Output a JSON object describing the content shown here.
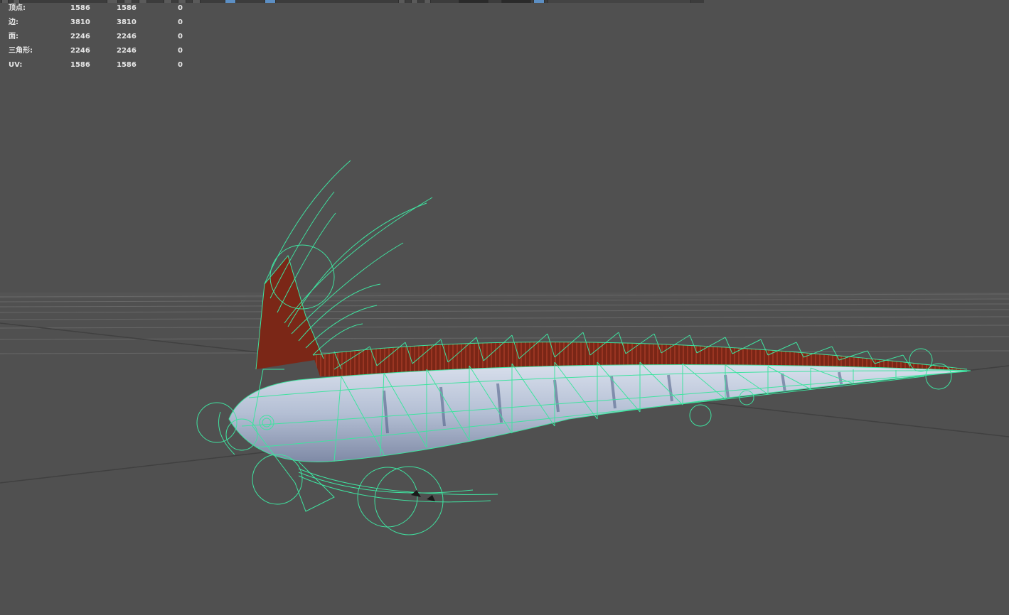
{
  "hud": {
    "rows": [
      {
        "label": "顶点:",
        "v1": "1586",
        "v2": "1586",
        "v3": "0"
      },
      {
        "label": "边:",
        "v1": "3810",
        "v2": "3810",
        "v3": "0"
      },
      {
        "label": "面:",
        "v1": "2246",
        "v2": "2246",
        "v3": "0"
      },
      {
        "label": "三角形:",
        "v1": "2246",
        "v2": "2246",
        "v3": "0"
      },
      {
        "label": "UV:",
        "v1": "1586",
        "v2": "1586",
        "v3": "0"
      }
    ]
  },
  "colors": {
    "background": "#505050",
    "wireframe": "#3fe3a0",
    "fin": "#8a2a1a",
    "body": "#b9c4d8",
    "grid": "#6a6a6a"
  }
}
